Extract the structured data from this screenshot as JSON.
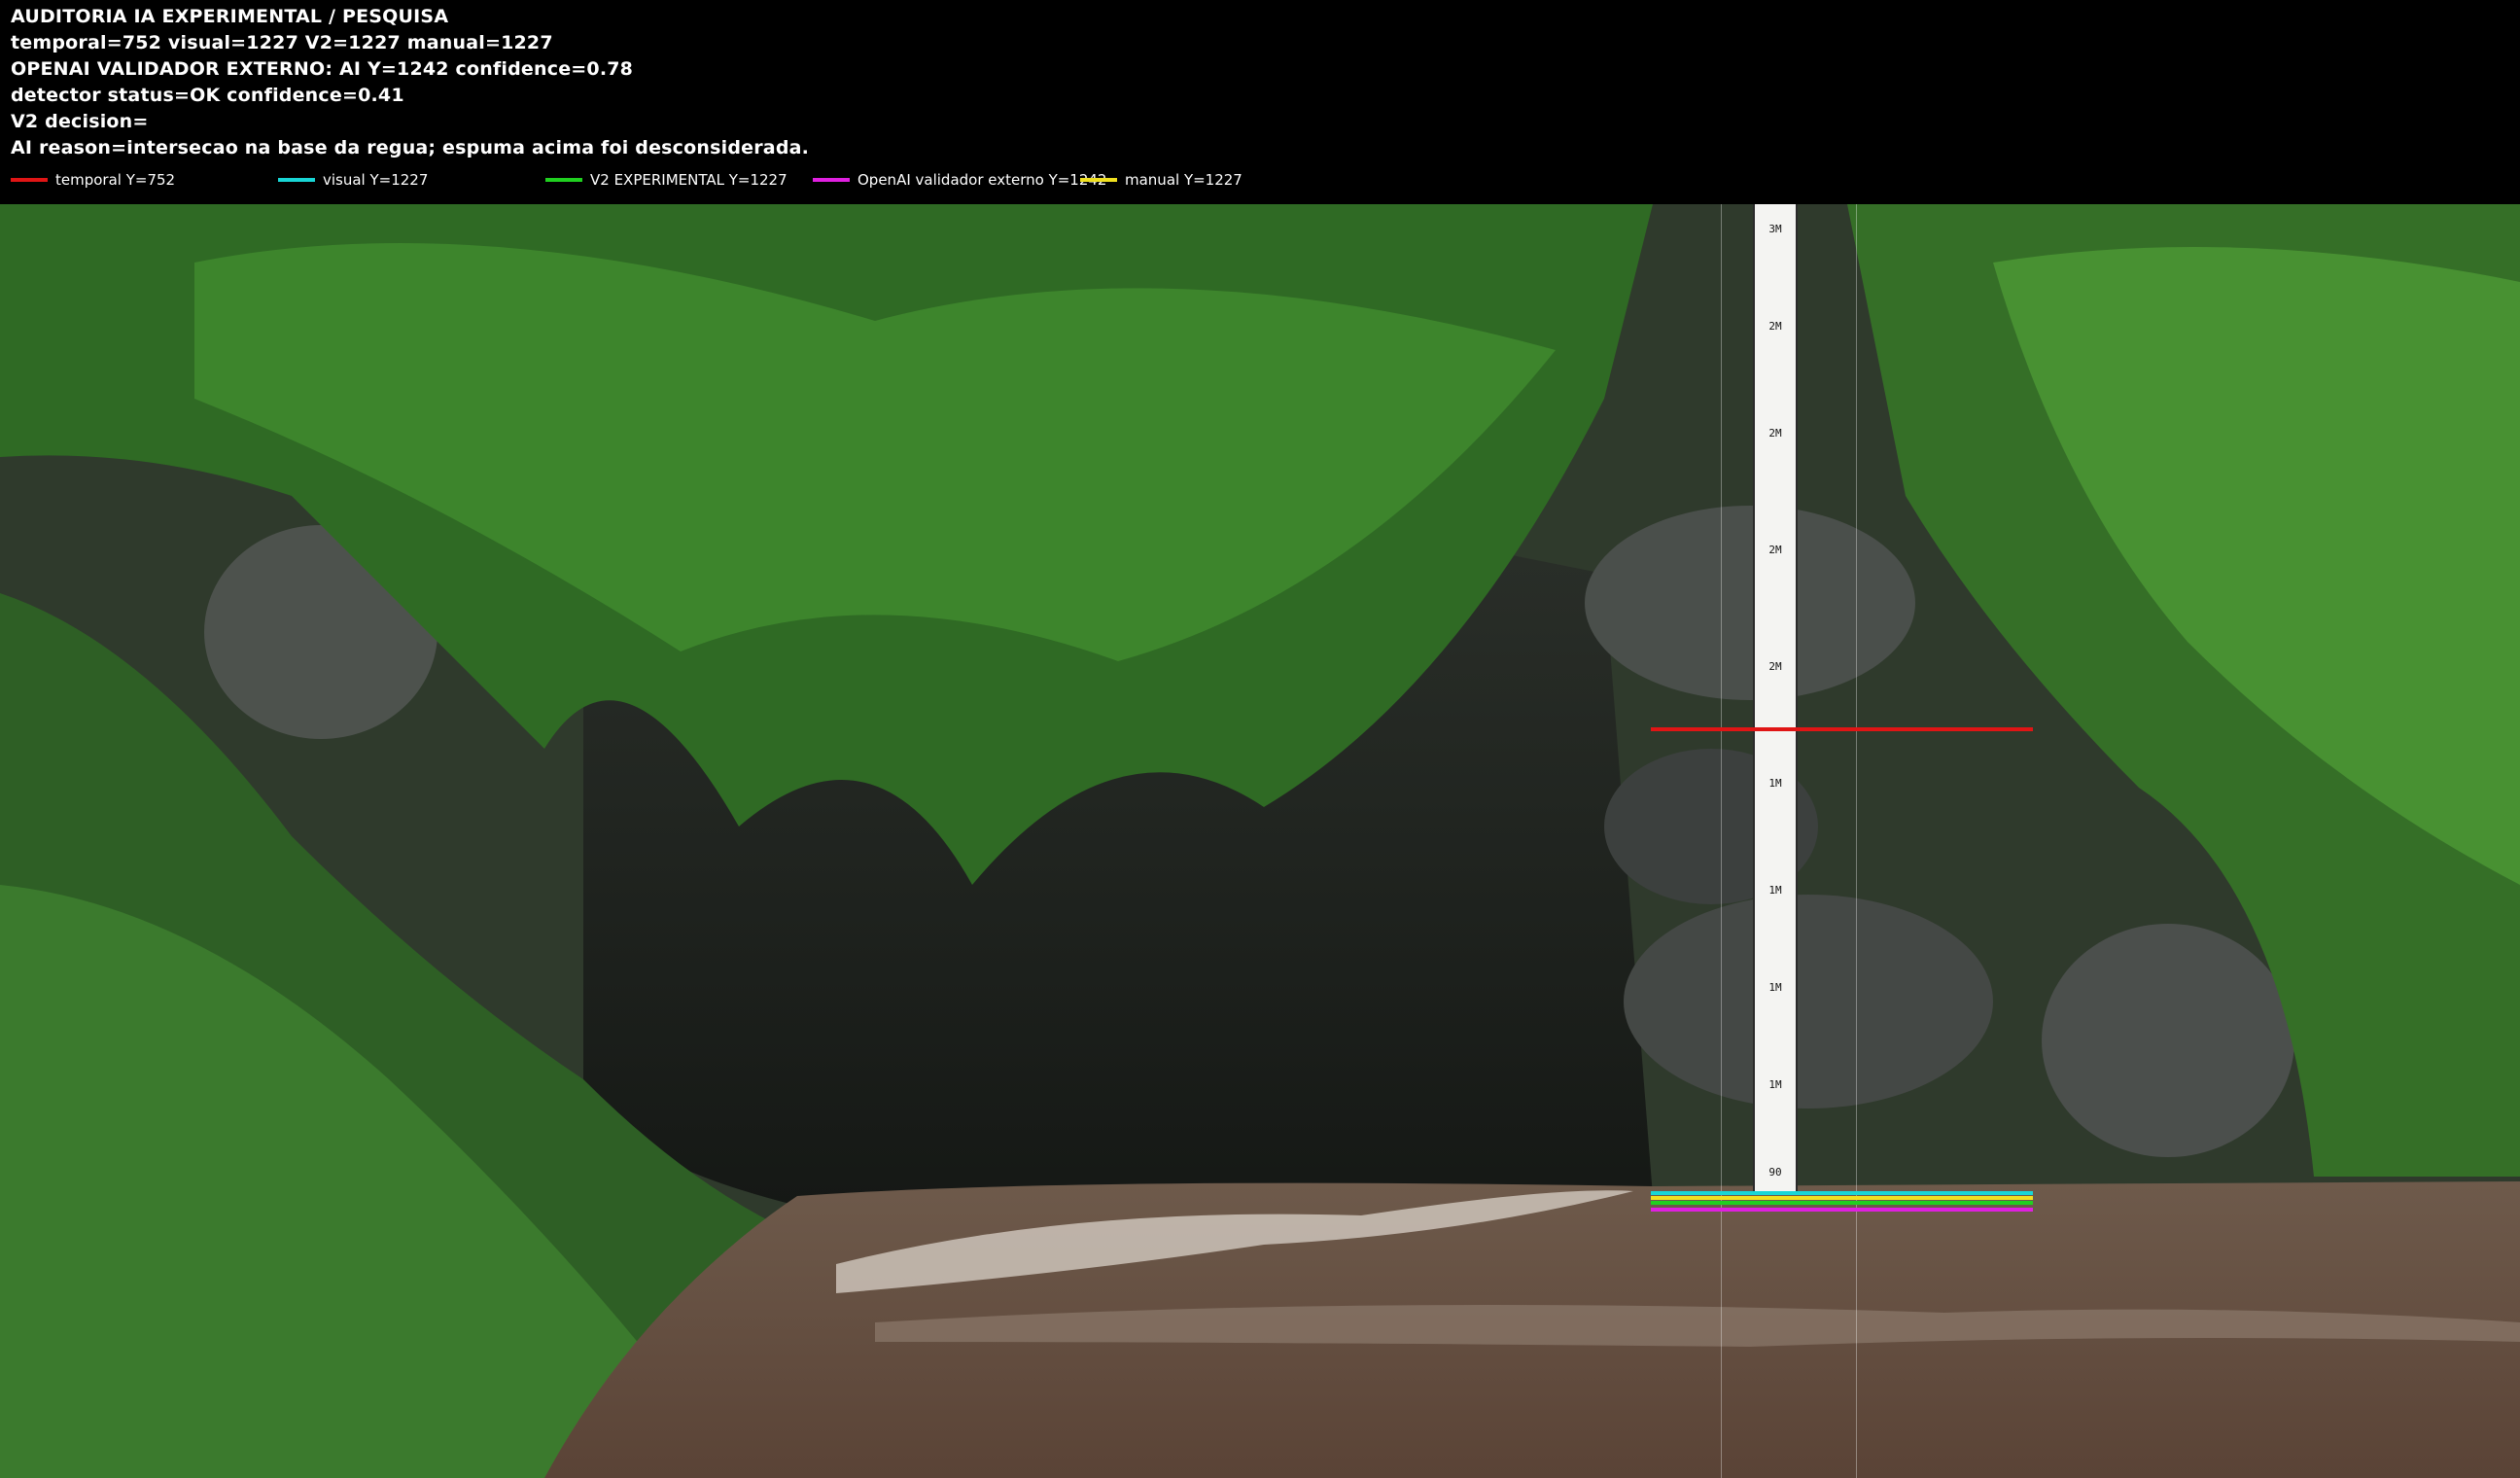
{
  "header": {
    "line1": "AUDITORIA IA  EXPERIMENTAL / PESQUISA",
    "line2": "temporal=752  visual=1227  V2=1227  manual=1227",
    "line3": "OPENAI  VALIDADOR EXTERNO: AI Y=1242  confidence=0.78",
    "line4": "detector status=OK confidence=0.41",
    "line5": "V2 decision=",
    "line6": "AI reason=intersecao na base da regua; espuma acima foi desconsiderada."
  },
  "legend": [
    {
      "label": "temporal Y=752",
      "color": "#e01515"
    },
    {
      "label": "visual Y=1227",
      "color": "#18d6d6"
    },
    {
      "label": "V2 EXPERIMENTAL Y=1227",
      "color": "#20d020"
    },
    {
      "label": "OpenAI validador externo Y=1242",
      "color": "#e020e0"
    },
    {
      "label": "manual Y=1227",
      "color": "#f0e020"
    }
  ],
  "gauge": {
    "marks": [
      "3M",
      "2M",
      "2M",
      "2M",
      "2M",
      "1M",
      "1M",
      "1M",
      "1M",
      "90"
    ]
  }
}
